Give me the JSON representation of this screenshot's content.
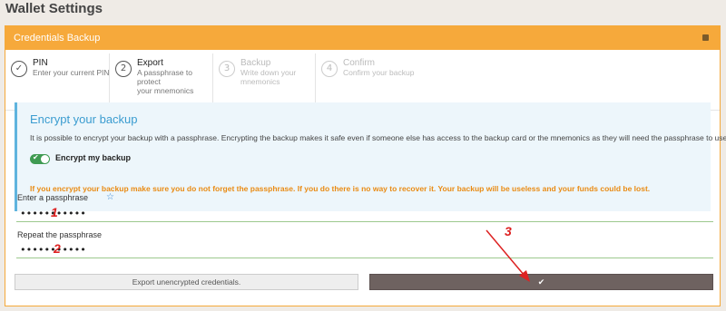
{
  "page": {
    "title": "Wallet Settings"
  },
  "panel": {
    "title": "Credentials Backup",
    "collapse_icon": "square-icon"
  },
  "steps": [
    {
      "number": "✓",
      "title": "PIN",
      "desc": "Enter your current PIN",
      "state": "done"
    },
    {
      "number": "2",
      "title": "Export",
      "desc1": "A passphrase to protect",
      "desc2": "your mnemonics",
      "state": "active"
    },
    {
      "number": "3",
      "title": "Backup",
      "desc1": "Write down your",
      "desc2": "mnemonics",
      "state": "inactive"
    },
    {
      "number": "4",
      "title": "Confirm",
      "desc": "Confirm your backup",
      "state": "inactive"
    }
  ],
  "encrypt": {
    "title": "Encrypt your backup",
    "text": "It is possible to encrypt your backup with a passphrase. Encrypting the backup makes it safe even if someone else has access to the backup card or the mnemonics as they will need the passphrase to use them.",
    "toggle_label": "Encrypt my backup",
    "toggle_on": true,
    "warning": "If you encrypt your backup make sure you do not forget the passphrase. If you do there is no way to recover it. Your backup will be useless and your funds could be lost."
  },
  "passphrase": {
    "label": "Enter a passphrase",
    "value": "•••••••••••",
    "marker": "1"
  },
  "repeat": {
    "label": "Repeat the passphrase",
    "value": "•••••••••••",
    "marker": "2"
  },
  "buttons": {
    "export_unencrypted": "Export unencrypted credentials.",
    "confirm_icon": "✔"
  },
  "annotation": {
    "marker": "3",
    "color": "#dd2222"
  },
  "colors": {
    "accent": "#f6a93b",
    "info": "#5fb4de",
    "toggle": "#3f9b52",
    "warning": "#e98b14",
    "primary_button": "#6e6260"
  }
}
